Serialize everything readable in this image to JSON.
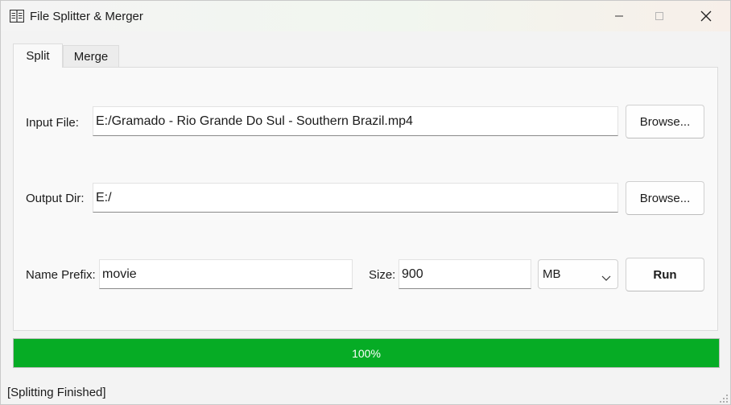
{
  "window": {
    "title": "File Splitter & Merger",
    "app_icon": "split-pane-icon"
  },
  "window_controls": {
    "minimize_icon": "minimize-icon",
    "maximize_icon": "maximize-icon",
    "close_icon": "close-icon"
  },
  "tabs": [
    {
      "label": "Split",
      "active": true
    },
    {
      "label": "Merge",
      "active": false
    }
  ],
  "split": {
    "input_file_label": "Input File:",
    "input_file_value": "E:/Gramado - Rio Grande Do Sul - Southern Brazil.mp4",
    "input_browse_label": "Browse...",
    "output_dir_label": "Output Dir:",
    "output_dir_value": "E:/",
    "output_browse_label": "Browse...",
    "name_prefix_label": "Name Prefix:",
    "name_prefix_value": "movie",
    "size_label": "Size:",
    "size_value": "900",
    "unit_selected": "MB",
    "run_label": "Run"
  },
  "progress": {
    "value": 100,
    "text": "100%",
    "color": "#06ac25"
  },
  "status": {
    "text": "[Splitting Finished]"
  },
  "colors": {
    "accent": "#06ac25",
    "window_bg": "#f3f3f3",
    "panel_bg": "#f9f9f9"
  }
}
